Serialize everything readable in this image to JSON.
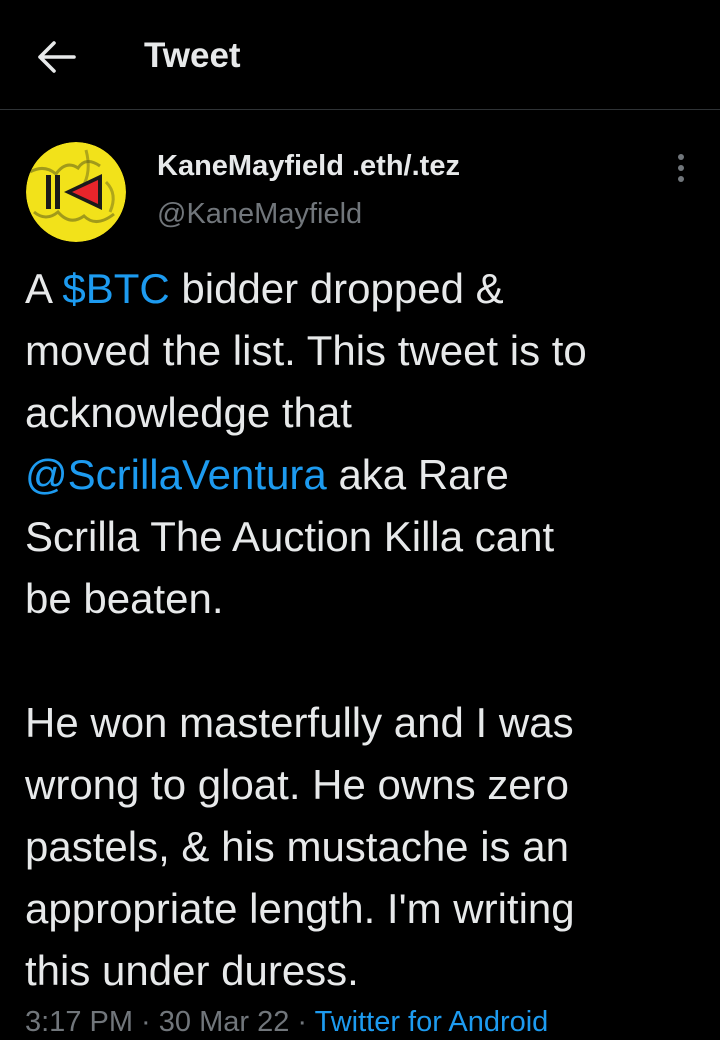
{
  "header": {
    "title": "Tweet",
    "back_icon": "arrow-left-icon"
  },
  "author": {
    "display_name": "KaneMayfield .eth/.tez",
    "handle": "@KaneMayfield",
    "avatar_colors": {
      "background": "#f2e21a",
      "mark": "#1a1a1a",
      "accent": "#e8252b"
    }
  },
  "more_icon": "more-vertical-icon",
  "tweet": {
    "line1": {
      "pre": "A ",
      "link": "$BTC",
      "post": " bidder dropped &"
    },
    "line2": "moved the list. This tweet is to",
    "line3": "acknowledge that",
    "line4": {
      "link": "@ScrillaVentura",
      "post": " aka Rare"
    },
    "line5": "Scrilla The Auction Killa cant",
    "line6": "be beaten.",
    "line7": "He won masterfully and I was",
    "line8": "wrong to gloat. He owns zero",
    "line9": "pastels, & his mustache is an",
    "line10": "appropriate length. I'm writing",
    "line11": "this under duress."
  },
  "meta": {
    "timestamp": "3:17 PM · 30 Mar 22 · ",
    "source": "Twitter for Android"
  },
  "colors": {
    "background": "#000000",
    "text": "#e7e9ea",
    "secondary": "#71767b",
    "link": "#1d9bf0",
    "divider": "#2f3336"
  }
}
